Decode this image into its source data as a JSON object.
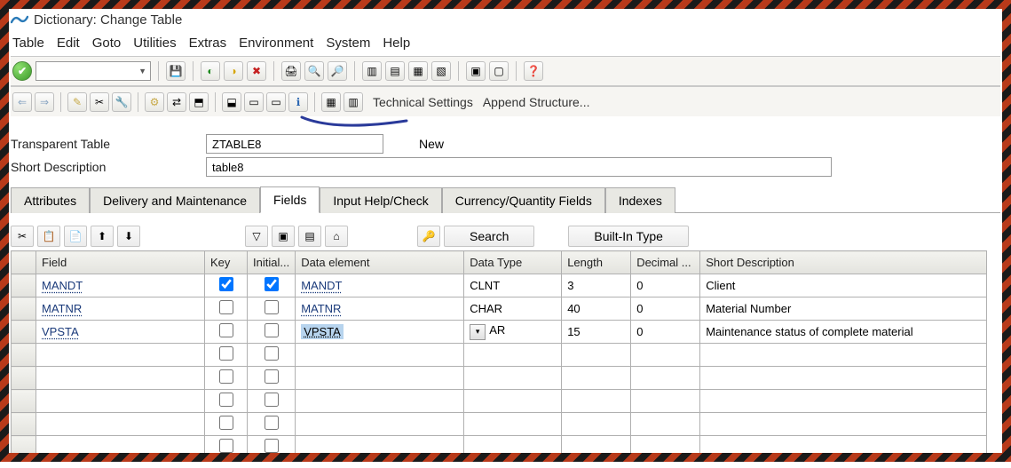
{
  "window": {
    "title": "Dictionary: Change Table"
  },
  "menu": [
    "Table",
    "Edit",
    "Goto",
    "Utilities",
    "Extras",
    "Environment",
    "System",
    "Help"
  ],
  "toolbar2": {
    "technical_settings": "Technical Settings",
    "append_structure": "Append Structure..."
  },
  "form": {
    "table_label": "Transparent Table",
    "table_value": "ZTABLE8",
    "status": "New",
    "short_desc_label": "Short Description",
    "short_desc_value": "table8"
  },
  "tabs": [
    "Attributes",
    "Delivery and Maintenance",
    "Fields",
    "Input Help/Check",
    "Currency/Quantity Fields",
    "Indexes"
  ],
  "active_tab": "Fields",
  "grid_toolbar": {
    "search": "Search",
    "builtin": "Built-In Type"
  },
  "grid": {
    "headers": {
      "field": "Field",
      "key": "Key",
      "initial": "Initial...",
      "data_element": "Data element",
      "data_type": "Data Type",
      "length": "Length",
      "decimal": "Decimal ...",
      "short_desc": "Short Description"
    },
    "rows": [
      {
        "field": "MANDT",
        "key": true,
        "initial": true,
        "data_element": "MANDT",
        "de_selected": false,
        "data_type": "CLNT",
        "dd": false,
        "length": "3",
        "decimal": "0",
        "short_desc": "Client"
      },
      {
        "field": "MATNR",
        "key": false,
        "initial": false,
        "data_element": "MATNR",
        "de_selected": false,
        "data_type": "CHAR",
        "dd": false,
        "length": "40",
        "decimal": "0",
        "short_desc": "Material Number"
      },
      {
        "field": "VPSTA",
        "key": false,
        "initial": false,
        "data_element": "VPSTA",
        "de_selected": true,
        "data_type": "AR",
        "dd": true,
        "length": "15",
        "decimal": "0",
        "short_desc": "Maintenance status of complete material"
      }
    ],
    "empty_rows": 5
  },
  "icons": {
    "back": "◀",
    "fwd": "▶",
    "save": "💾",
    "b1": "◐",
    "b2": "◑",
    "exit": "✖",
    "print": "🖨",
    "find": "🔍",
    "findn": "🔎",
    "n1": "▥",
    "n2": "▤",
    "n3": "▦",
    "n4": "▧",
    "l1": "▣",
    "l2": "▢",
    "help": "❓",
    "t1": "⇐",
    "t2": "⇒",
    "t3": "✎",
    "t4": "✂",
    "t5": "🔧",
    "t6": "⚙",
    "t7": "⇄",
    "t8": "⬒",
    "t9": "⬓",
    "t10": "▭",
    "t11": "ℹ",
    "t12": "▦",
    "t13": "▥",
    "g1": "✂",
    "g2": "📋",
    "g3": "📄",
    "g4": "⬆",
    "g5": "⬇",
    "g6": "▽",
    "g7": "▣",
    "g8": "▤",
    "g9": "⌂",
    "gk": "🔑"
  }
}
